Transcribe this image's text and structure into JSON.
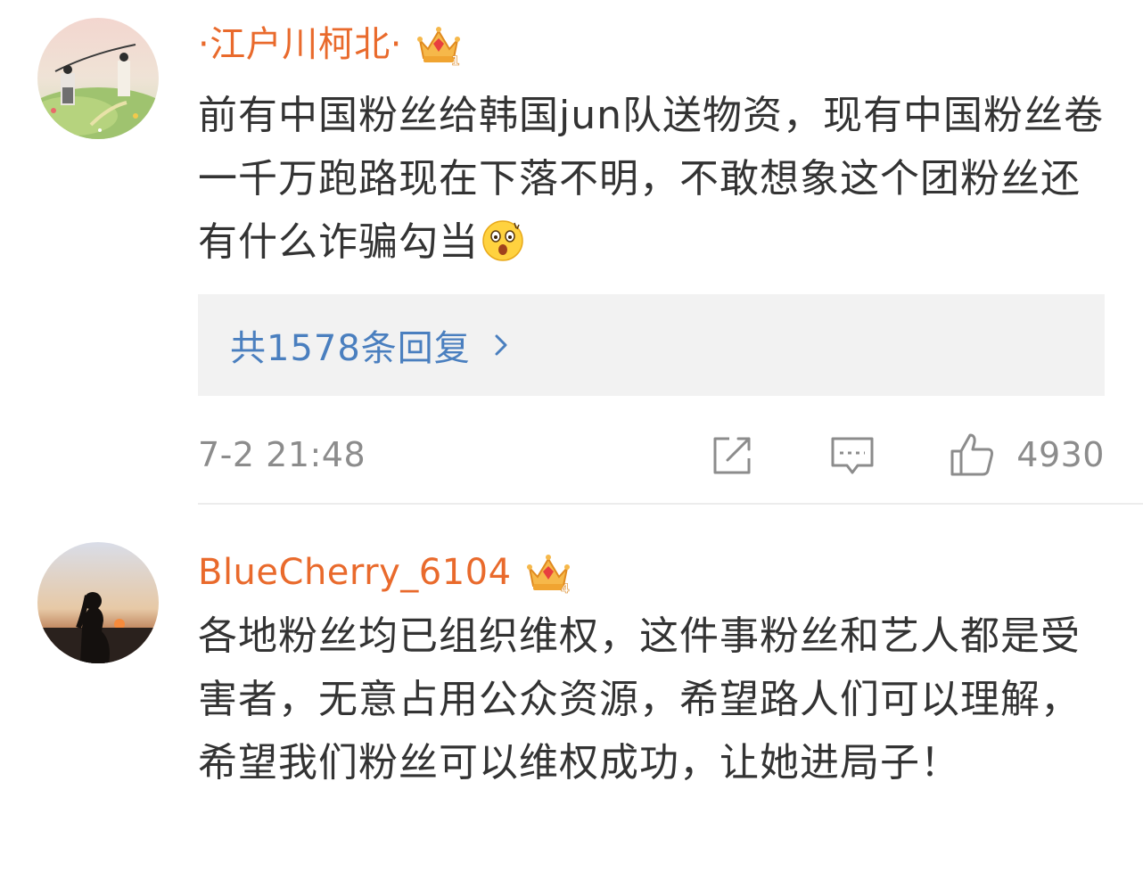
{
  "comments": [
    {
      "username": "·江户川柯北·",
      "vip_level": "1",
      "text": "前有中国粉丝给韩国jun队送物资，现有中国粉丝卷一千万跑路现在下落不明，不敢想象这个团粉丝还有什么诈骗勾当",
      "emoji": "surprised-face",
      "replies_label": "共1578条回复",
      "timestamp": "7-2 21:48",
      "likes": "4930"
    },
    {
      "username": "BlueCherry_6104",
      "vip_level": "4",
      "text": "各地粉丝均已组织维权，这件事粉丝和艺人都是受害者，无意占用公众资源，希望路人们可以理解，希望我们粉丝可以维权成功，让她进局子！"
    }
  ],
  "colors": {
    "username": "#e96a2c",
    "body_text": "#333333",
    "replies_link": "#4a7fbf",
    "meta_gray": "#8c8c8c",
    "replies_bg": "#f2f2f2"
  }
}
